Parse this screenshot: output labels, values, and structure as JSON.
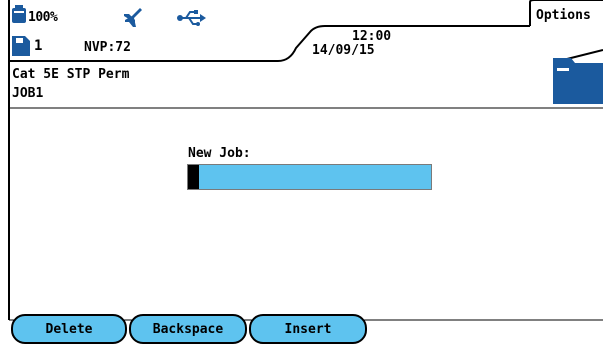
{
  "header": {
    "battery_percent": "100%",
    "card_number": "1",
    "nvp": "NVP:72",
    "time": "12:00",
    "date": "14/09/15",
    "options_label": "Options"
  },
  "test": {
    "type": "Cat 5E STP Perm",
    "job": "JOB1"
  },
  "dialog": {
    "label": "New Job:",
    "value": ""
  },
  "softkeys": {
    "delete": "Delete",
    "backspace": "Backspace",
    "insert": "Insert"
  },
  "colors": {
    "accent": "#5ec3ef",
    "icon_blue": "#1b5a9e"
  },
  "icons": [
    "battery-icon",
    "mute-speaker-icon",
    "usb-icon",
    "memory-card-icon",
    "folder-icon"
  ]
}
